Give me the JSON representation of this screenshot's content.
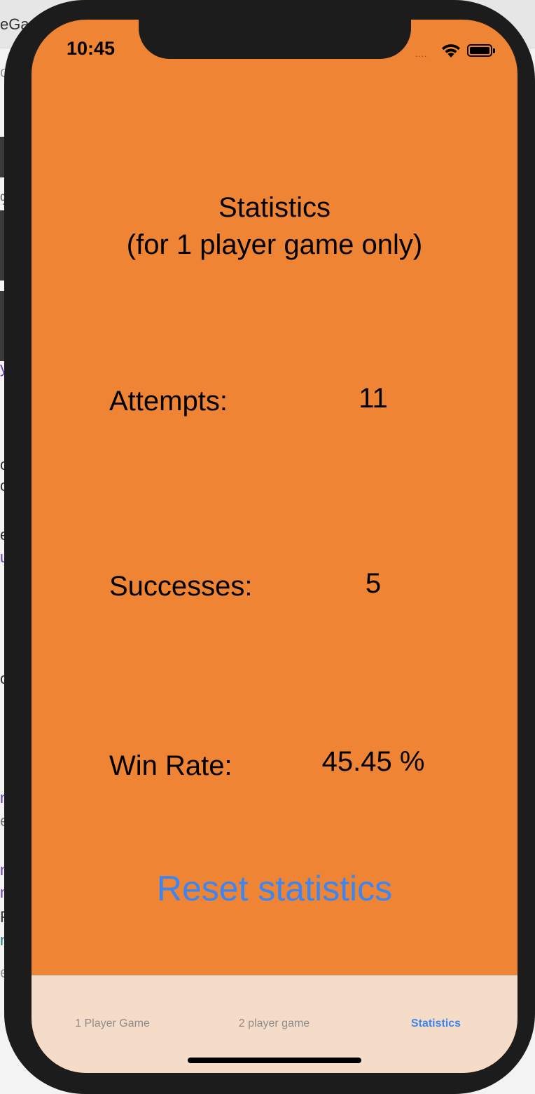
{
  "status_bar": {
    "time": "10:45",
    "signal": "....",
    "wifi_icon": "wifi-icon",
    "battery_icon": "battery-icon"
  },
  "background_fragments": [
    "eGa",
    "o",
    "%",
    "y",
    "c",
    "c",
    "e",
    "u",
    "o",
    "n",
    "e",
    "n",
    "n",
    "F",
    "n",
    "e"
  ],
  "screen": {
    "title": "Statistics\n(for 1 player game only)",
    "stats": [
      {
        "label": "Attempts:",
        "value": "11"
      },
      {
        "label": "Successes:",
        "value": "5"
      },
      {
        "label": "Win Rate:",
        "value": "45.45 %"
      }
    ],
    "reset_button": "Reset statistics"
  },
  "tab_bar": {
    "tabs": [
      {
        "label": "1 Player Game",
        "active": false
      },
      {
        "label": "2 player game",
        "active": false
      },
      {
        "label": "Statistics",
        "active": true
      }
    ]
  },
  "colors": {
    "screen_background": "#ef8434",
    "tab_bar_background": "#f5dcc8",
    "accent": "#3b86f0",
    "inactive_tab": "#8c8c8c"
  }
}
